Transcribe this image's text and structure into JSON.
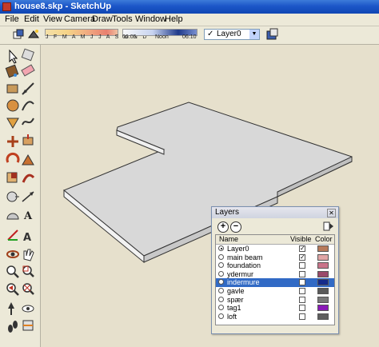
{
  "window": {
    "title": "house8.skp - SketchUp"
  },
  "menu": [
    "File",
    "Edit",
    "View",
    "Camera",
    "Draw",
    "Tools",
    "Window",
    "Help"
  ],
  "toolbar": {
    "shadow_months": "J F M A M J J A S O N D",
    "time_start": "06:05",
    "time_noon": "Noon",
    "time_end": "06:10",
    "layer_value": "Layer0"
  },
  "layers_panel": {
    "title": "Layers",
    "columns": {
      "name": "Name",
      "visible": "Visible",
      "color": "Color"
    },
    "rows": [
      {
        "name": "Layer0",
        "active": true,
        "visible": true,
        "color": "#b87a5a"
      },
      {
        "name": "main beam",
        "active": false,
        "visible": true,
        "color": "#e0a5a5"
      },
      {
        "name": "foundation",
        "active": false,
        "visible": false,
        "color": "#c9748a"
      },
      {
        "name": "ydermur",
        "active": false,
        "visible": false,
        "color": "#9a4a6a"
      },
      {
        "name": "indermure",
        "active": false,
        "visible": false,
        "color": "#142a8a",
        "selected": true
      },
      {
        "name": "gavle",
        "active": false,
        "visible": false,
        "color": "#5a5a5a"
      },
      {
        "name": "spær",
        "active": false,
        "visible": false,
        "color": "#787878"
      },
      {
        "name": "tag1",
        "active": false,
        "visible": false,
        "color": "#8a1ab8"
      },
      {
        "name": "loft",
        "active": false,
        "visible": false,
        "color": "#5e5e5e"
      }
    ]
  }
}
